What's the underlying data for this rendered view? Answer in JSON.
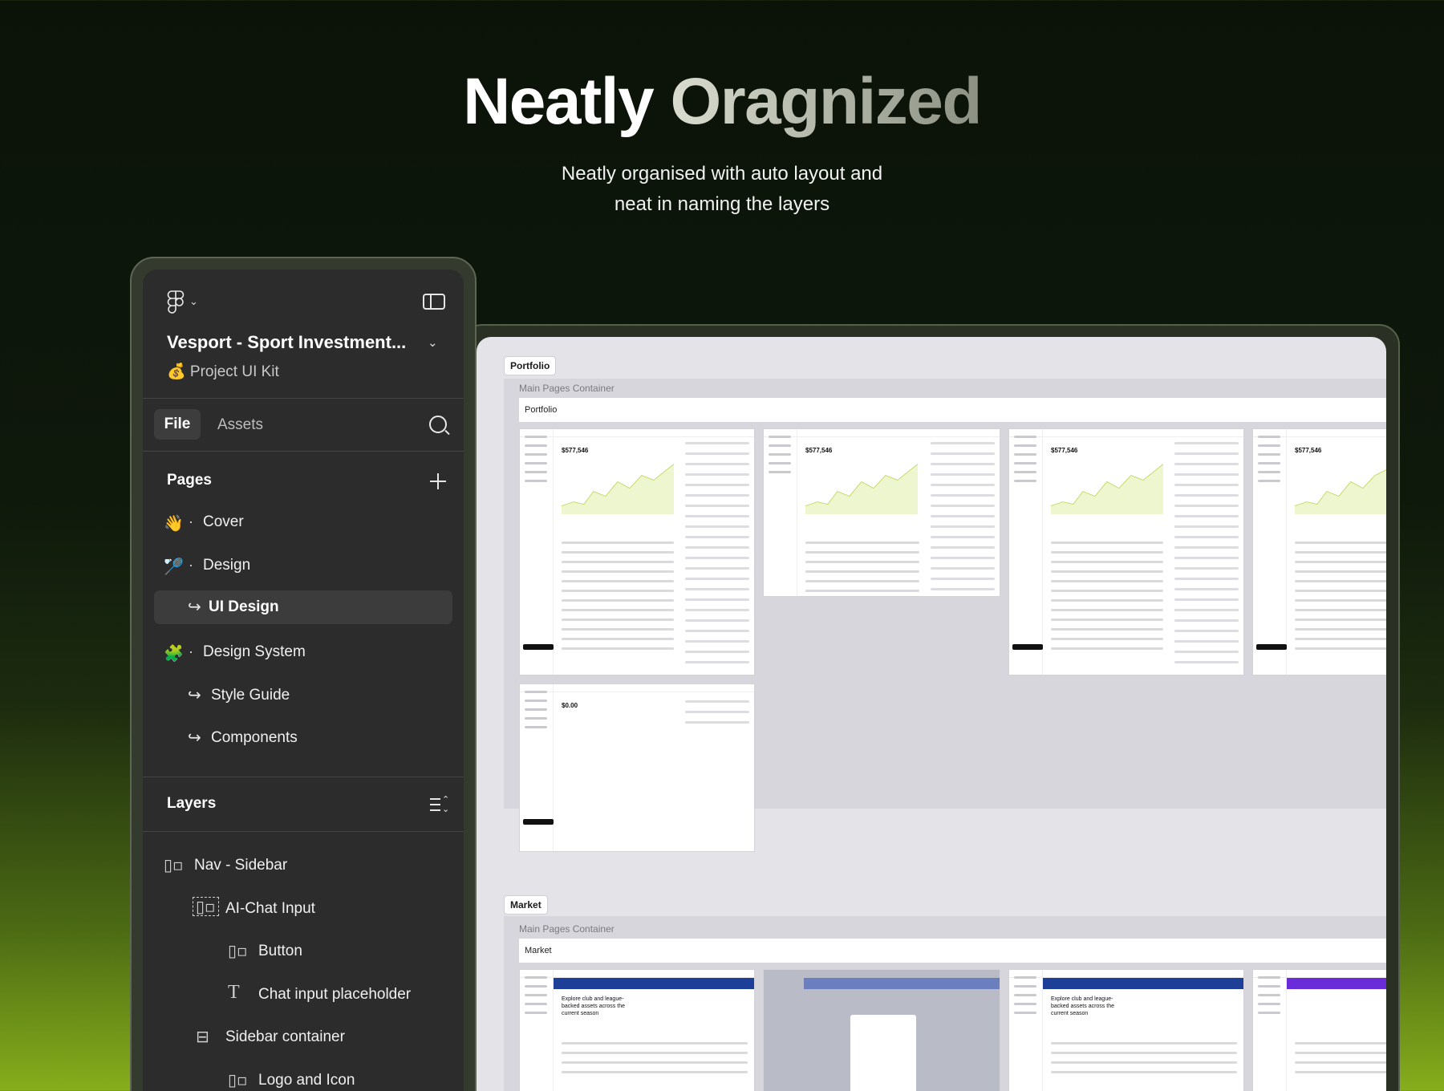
{
  "hero": {
    "title_part1": "Neatly",
    "title_part2": "Oragnized",
    "subtitle_line1": "Neatly organised with auto layout and",
    "subtitle_line2": "neat in naming the layers"
  },
  "figma_panel": {
    "logo_icon": "figma-logo-icon",
    "project_title": "Vesport - Sport Investment...",
    "project_subtitle": "💰 Project UI Kit",
    "tabs": {
      "file": "File",
      "assets": "Assets"
    },
    "pages_heading": "Pages",
    "pages": [
      {
        "emoji": "👋",
        "label": "Cover"
      },
      {
        "emoji": "🏸",
        "label": "Design"
      },
      {
        "label": "UI Design",
        "selected": true
      },
      {
        "emoji": "🧩",
        "label": "Design System"
      },
      {
        "label": "Style Guide"
      },
      {
        "label": "Components"
      }
    ],
    "layers_heading": "Layers",
    "layers": [
      {
        "icon": "auto-layout-horizontal-icon",
        "label": "Nav - Sidebar"
      },
      {
        "icon": "frame-auto-layout-icon",
        "label": "AI-Chat Input"
      },
      {
        "icon": "auto-layout-horizontal-icon",
        "label": "Button"
      },
      {
        "icon": "text-icon",
        "label": "Chat input placeholder"
      },
      {
        "icon": "auto-layout-vertical-icon",
        "label": "Sidebar container"
      },
      {
        "icon": "auto-layout-horizontal-icon",
        "label": "Logo and Icon"
      }
    ]
  },
  "canvas": {
    "sections": [
      {
        "tag": "Portfolio",
        "container_label": "Main Pages Container",
        "container_title": "Portfolio",
        "sample_value": "$577,546",
        "empty_value": "$0.00"
      },
      {
        "tag": "Market",
        "container_label": "Main Pages Container",
        "container_title": "Market",
        "hero_text": "Explore club and league-backed assets across the current season"
      }
    ]
  },
  "colors": {
    "background_top": "#0b1309",
    "background_bottom": "#86ae1c",
    "panel_bg": "#2c2c2c",
    "canvas_bg": "#e4e4e8",
    "market_accent": "#1d3f98"
  }
}
